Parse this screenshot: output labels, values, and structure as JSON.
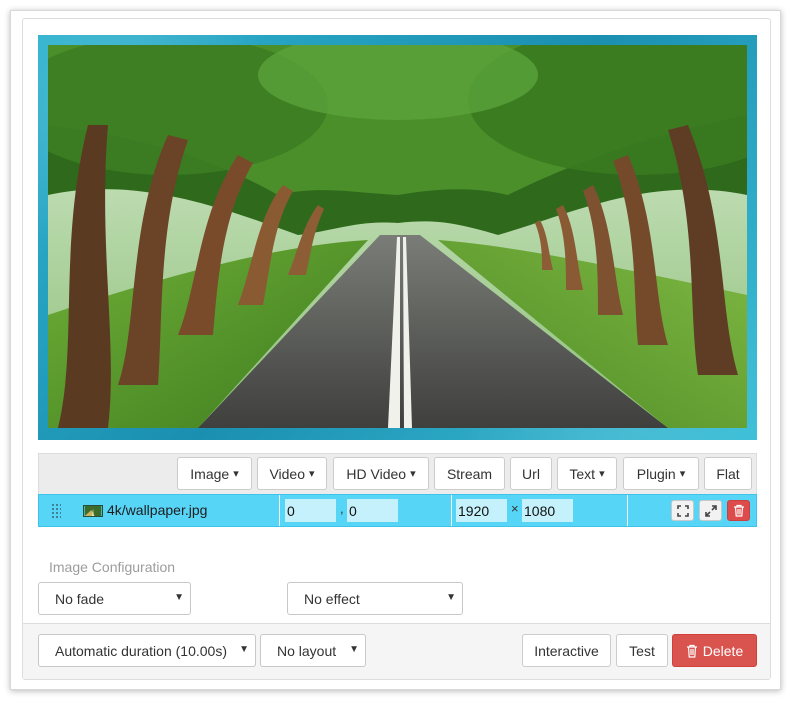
{
  "toolbar": {
    "buttons": [
      {
        "label": "Image",
        "caret": "▾"
      },
      {
        "label": "Video",
        "caret": "▾"
      },
      {
        "label": "HD Video",
        "caret": "▾"
      },
      {
        "label": "Stream",
        "caret": ""
      },
      {
        "label": "Url",
        "caret": ""
      },
      {
        "label": "Text",
        "caret": "▾"
      },
      {
        "label": "Plugin",
        "caret": "▾"
      },
      {
        "label": "Flat",
        "caret": ""
      }
    ]
  },
  "media_item": {
    "filename": "4k/wallpaper.jpg",
    "x": "0",
    "coord_sep": ",",
    "y": "0",
    "width": "1920",
    "size_sep": "×",
    "height": "1080",
    "icons": [
      "fit-icon",
      "expand-icon",
      "trash-icon"
    ]
  },
  "config": {
    "label": "Image Configuration",
    "fade_value": "No fade",
    "effect_value": "No effect"
  },
  "footer": {
    "duration_value": "Automatic duration (10.00s)",
    "layout_value": "No layout",
    "interactive_label": "Interactive",
    "test_label": "Test",
    "delete_label": "Delete"
  },
  "colors": {
    "frame_border": "#33a6c2",
    "row_highlight": "#57d5f7",
    "danger": "#d9534f"
  }
}
